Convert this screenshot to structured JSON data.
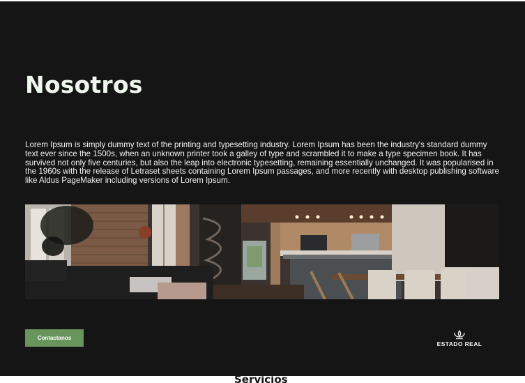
{
  "about": {
    "title": "Nosotros",
    "body": "Lorem Ipsum is simply dummy text of the printing and typesetting industry. Lorem Ipsum has been the industry's standard dummy text ever since the 1500s, when an unknown printer took a galley of type and scrambled it to make a type specimen book. It has survived not only five centuries, but also the leap into electronic typesetting, remaining essentially unchanged. It was popularised in the 1960s with the release of Letraset sheets containing Lorem Ipsum passages, and more recently with desktop publishing software like Aldus PageMaker including versions of Lorem Ipsum.",
    "banner_image": "interior-loft-kitchen-photo",
    "cta_label": "Contactanos"
  },
  "brand": {
    "logo_icon": "crown-lotus-icon",
    "logo_text": "ESTADO REAL"
  },
  "next_section": {
    "heading_partial": "Servicios"
  },
  "colors": {
    "background": "#151515",
    "title": "#edf7ec",
    "accent": "#67955c",
    "text": "#f2f2f2"
  }
}
